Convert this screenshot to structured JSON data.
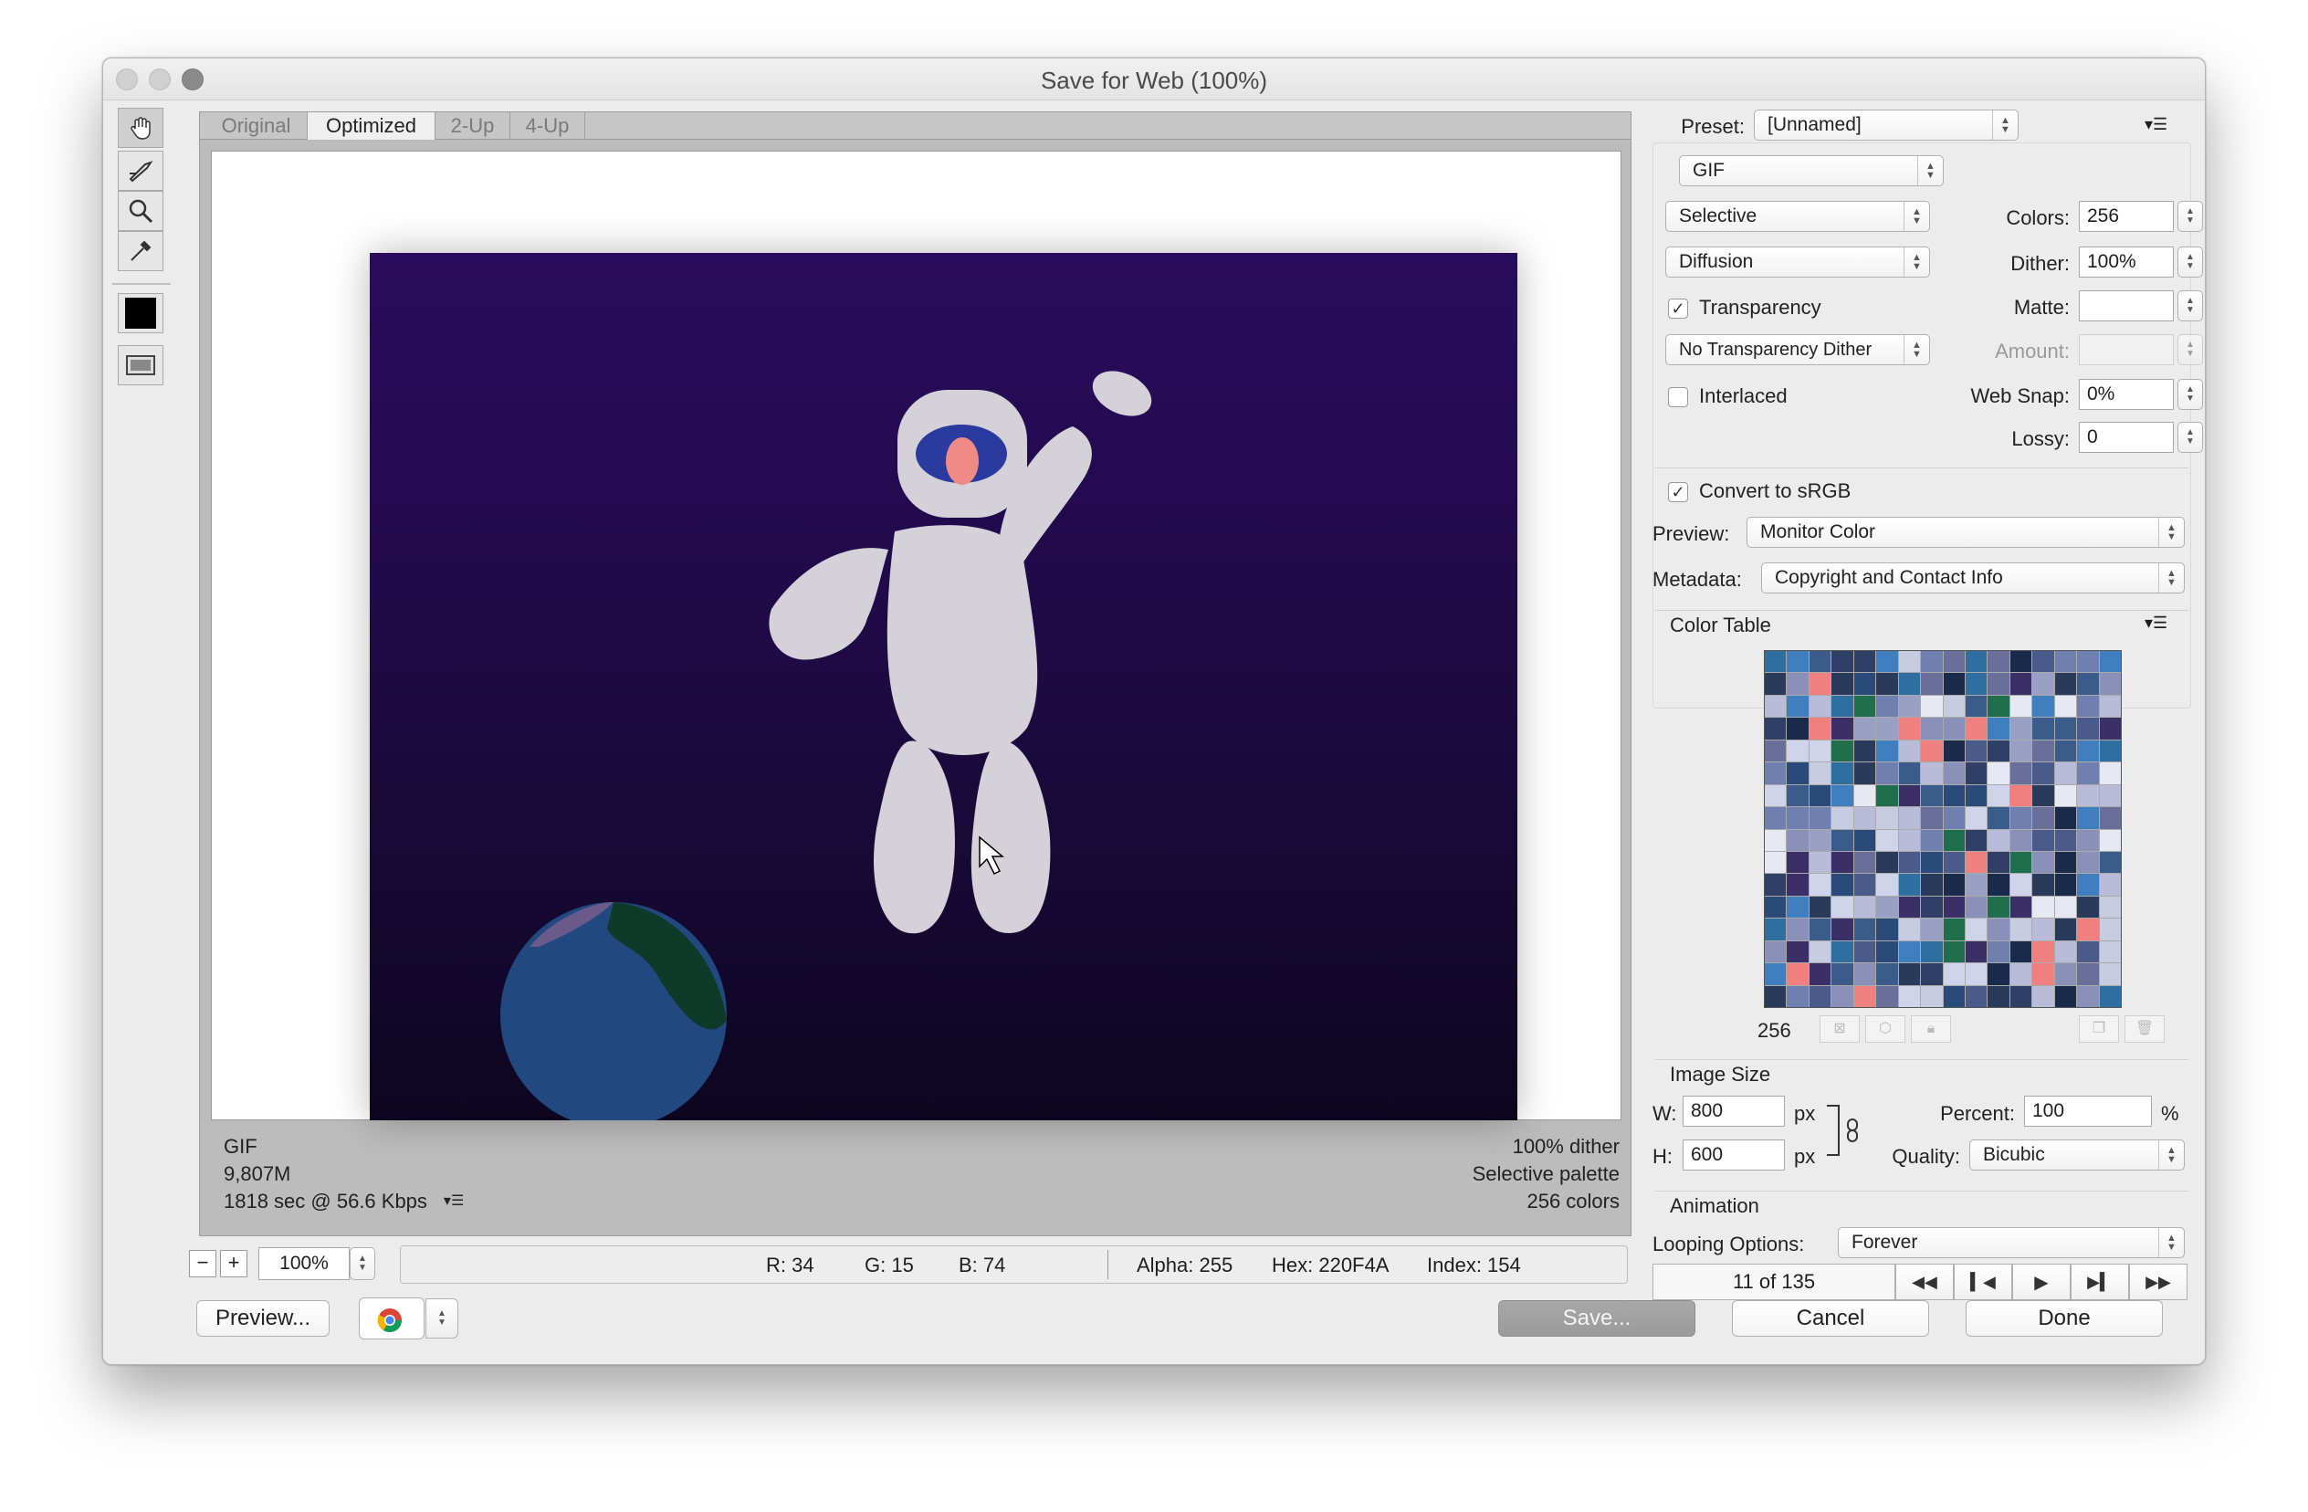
{
  "window": {
    "title": "Save for Web (100%)"
  },
  "tabs": [
    "Original",
    "Optimized",
    "2-Up",
    "4-Up"
  ],
  "image_info": {
    "left": [
      "GIF",
      "9,807M",
      "1818 sec @ 56.6 Kbps"
    ],
    "right": [
      "100% dither",
      "Selective palette",
      "256 colors"
    ]
  },
  "status": {
    "zoom": "100%",
    "r": "R: 34",
    "g": "G: 15",
    "b": "B: 74",
    "alpha": "Alpha: 255",
    "hex": "Hex: 220F4A",
    "index": "Index: 154"
  },
  "bottom": {
    "preview_btn": "Preview...",
    "save_btn": "Save...",
    "cancel_btn": "Cancel",
    "done_btn": "Done"
  },
  "settings": {
    "preset_label": "Preset:",
    "preset_value": "[Unnamed]",
    "format": "GIF",
    "reduction": "Selective",
    "dither_algo": "Diffusion",
    "colors_label": "Colors:",
    "colors_value": "256",
    "dither_label": "Dither:",
    "dither_value": "100%",
    "transparency": "Transparency",
    "matte_label": "Matte:",
    "transparency_dither": "No Transparency Dither",
    "amount_label": "Amount:",
    "interlaced": "Interlaced",
    "websnap_label": "Web Snap:",
    "websnap_value": "0%",
    "lossy_label": "Lossy:",
    "lossy_value": "0",
    "convert_srgb": "Convert to sRGB",
    "preview_label": "Preview:",
    "preview_value": "Monitor Color",
    "metadata_label": "Metadata:",
    "metadata_value": "Copyright and Contact Info"
  },
  "color_table": {
    "title": "Color Table",
    "count": "256"
  },
  "image_size": {
    "title": "Image Size",
    "w_label": "W:",
    "w_value": "800",
    "h_label": "H:",
    "h_value": "600",
    "unit": "px",
    "percent_label": "Percent:",
    "percent_value": "100",
    "percent_sign": "%",
    "quality_label": "Quality:",
    "quality_value": "Bicubic"
  },
  "animation": {
    "title": "Animation",
    "looping_label": "Looping Options:",
    "looping_value": "Forever",
    "frame": "11 of 135"
  },
  "palette": [
    "#3b5b8a",
    "#6f7fb0",
    "#9aa0c4",
    "#2f3f66",
    "#1f6f4f",
    "#2a4a7a",
    "#b8bcd8",
    "#3a2f66",
    "#2f6f9f",
    "#8a90b8",
    "#c8cce0",
    "#d0d4ea",
    "#4a5a8a",
    "#2a3a5a",
    "#6a6f9a",
    "#1a2a4a",
    "#e6e8f4",
    "#f08080",
    "#3f7fbf"
  ]
}
